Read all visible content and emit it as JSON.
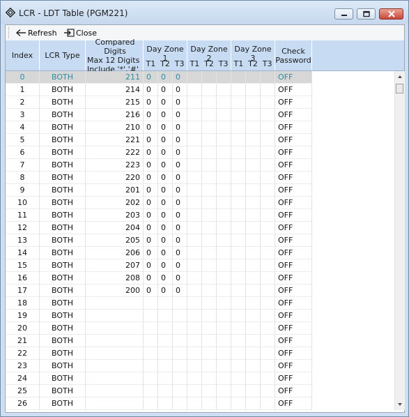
{
  "window": {
    "title": "LCR - LDT Table (PGM221)",
    "accent": "#c7dcf3"
  },
  "toolbar": {
    "refresh_label": "Refresh",
    "close_label": "Close"
  },
  "table": {
    "headers": {
      "index": "Index",
      "lcr_type": "LCR Type",
      "compared_digits_1": "Compared Digits",
      "compared_digits_2": "Max 12 Digits",
      "compared_digits_3": "Include '*','#'",
      "day_zone_1": "Day Zone 1",
      "day_zone_2": "Day Zone 2",
      "day_zone_3": "Day Zone 3",
      "t1": "T1",
      "t2": "T2",
      "t3": "T3",
      "check_1": "Check",
      "check_2": "Password"
    },
    "rows": [
      {
        "index": "0",
        "type": "BOTH",
        "digits": "211",
        "t1": "0",
        "t2": "0",
        "t3": "0",
        "pw": "OFF"
      },
      {
        "index": "1",
        "type": "BOTH",
        "digits": "214",
        "t1": "0",
        "t2": "0",
        "t3": "0",
        "pw": "OFF"
      },
      {
        "index": "2",
        "type": "BOTH",
        "digits": "215",
        "t1": "0",
        "t2": "0",
        "t3": "0",
        "pw": "OFF"
      },
      {
        "index": "3",
        "type": "BOTH",
        "digits": "216",
        "t1": "0",
        "t2": "0",
        "t3": "0",
        "pw": "OFF"
      },
      {
        "index": "4",
        "type": "BOTH",
        "digits": "210",
        "t1": "0",
        "t2": "0",
        "t3": "0",
        "pw": "OFF"
      },
      {
        "index": "5",
        "type": "BOTH",
        "digits": "221",
        "t1": "0",
        "t2": "0",
        "t3": "0",
        "pw": "OFF"
      },
      {
        "index": "6",
        "type": "BOTH",
        "digits": "222",
        "t1": "0",
        "t2": "0",
        "t3": "0",
        "pw": "OFF"
      },
      {
        "index": "7",
        "type": "BOTH",
        "digits": "223",
        "t1": "0",
        "t2": "0",
        "t3": "0",
        "pw": "OFF"
      },
      {
        "index": "8",
        "type": "BOTH",
        "digits": "220",
        "t1": "0",
        "t2": "0",
        "t3": "0",
        "pw": "OFF"
      },
      {
        "index": "9",
        "type": "BOTH",
        "digits": "201",
        "t1": "0",
        "t2": "0",
        "t3": "0",
        "pw": "OFF"
      },
      {
        "index": "10",
        "type": "BOTH",
        "digits": "202",
        "t1": "0",
        "t2": "0",
        "t3": "0",
        "pw": "OFF"
      },
      {
        "index": "11",
        "type": "BOTH",
        "digits": "203",
        "t1": "0",
        "t2": "0",
        "t3": "0",
        "pw": "OFF"
      },
      {
        "index": "12",
        "type": "BOTH",
        "digits": "204",
        "t1": "0",
        "t2": "0",
        "t3": "0",
        "pw": "OFF"
      },
      {
        "index": "13",
        "type": "BOTH",
        "digits": "205",
        "t1": "0",
        "t2": "0",
        "t3": "0",
        "pw": "OFF"
      },
      {
        "index": "14",
        "type": "BOTH",
        "digits": "206",
        "t1": "0",
        "t2": "0",
        "t3": "0",
        "pw": "OFF"
      },
      {
        "index": "15",
        "type": "BOTH",
        "digits": "207",
        "t1": "0",
        "t2": "0",
        "t3": "0",
        "pw": "OFF"
      },
      {
        "index": "16",
        "type": "BOTH",
        "digits": "208",
        "t1": "0",
        "t2": "0",
        "t3": "0",
        "pw": "OFF"
      },
      {
        "index": "17",
        "type": "BOTH",
        "digits": "200",
        "t1": "0",
        "t2": "0",
        "t3": "0",
        "pw": "OFF"
      },
      {
        "index": "18",
        "type": "BOTH",
        "digits": "",
        "t1": "",
        "t2": "",
        "t3": "",
        "pw": "OFF"
      },
      {
        "index": "19",
        "type": "BOTH",
        "digits": "",
        "t1": "",
        "t2": "",
        "t3": "",
        "pw": "OFF"
      },
      {
        "index": "20",
        "type": "BOTH",
        "digits": "",
        "t1": "",
        "t2": "",
        "t3": "",
        "pw": "OFF"
      },
      {
        "index": "21",
        "type": "BOTH",
        "digits": "",
        "t1": "",
        "t2": "",
        "t3": "",
        "pw": "OFF"
      },
      {
        "index": "22",
        "type": "BOTH",
        "digits": "",
        "t1": "",
        "t2": "",
        "t3": "",
        "pw": "OFF"
      },
      {
        "index": "23",
        "type": "BOTH",
        "digits": "",
        "t1": "",
        "t2": "",
        "t3": "",
        "pw": "OFF"
      },
      {
        "index": "24",
        "type": "BOTH",
        "digits": "",
        "t1": "",
        "t2": "",
        "t3": "",
        "pw": "OFF"
      },
      {
        "index": "25",
        "type": "BOTH",
        "digits": "",
        "t1": "",
        "t2": "",
        "t3": "",
        "pw": "OFF"
      },
      {
        "index": "26",
        "type": "BOTH",
        "digits": "",
        "t1": "",
        "t2": "",
        "t3": "",
        "pw": "OFF"
      }
    ],
    "selected_row": "0"
  }
}
